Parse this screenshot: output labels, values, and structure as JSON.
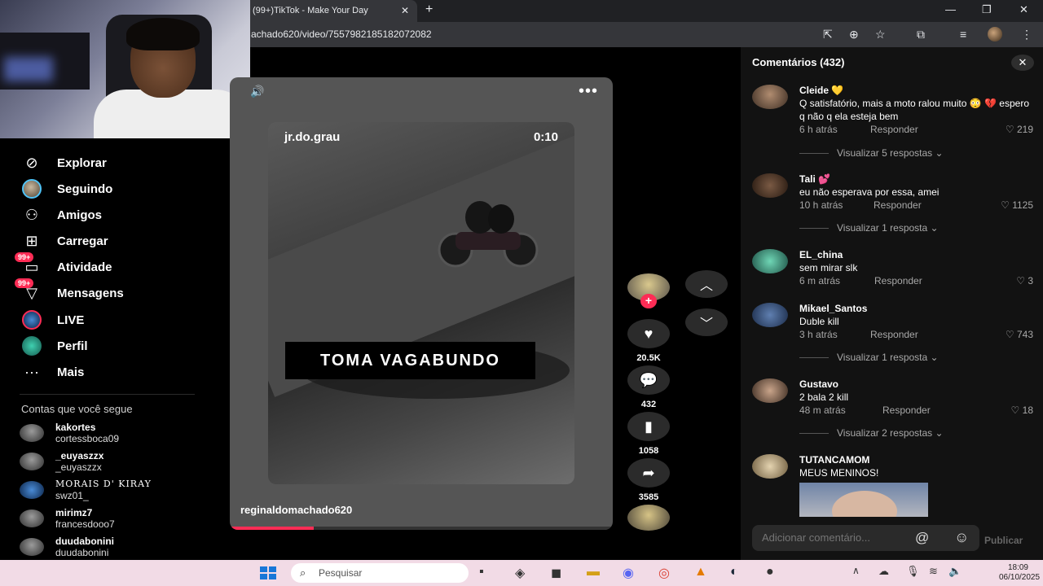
{
  "browser": {
    "tab_title": "(99+)TikTok - Make Your Day",
    "url": "achado620/video/7557982185182072082"
  },
  "nav": {
    "items": [
      {
        "label": "Explorar",
        "icon": "compass-icon"
      },
      {
        "label": "Seguindo",
        "icon": "avatar-icon"
      },
      {
        "label": "Amigos",
        "icon": "friends-icon"
      },
      {
        "label": "Carregar",
        "icon": "upload-icon"
      },
      {
        "label": "Atividade",
        "icon": "activity-icon",
        "badge": "99+"
      },
      {
        "label": "Mensagens",
        "icon": "messages-icon",
        "badge": "99+"
      },
      {
        "label": "LIVE",
        "icon": "live-icon"
      },
      {
        "label": "Perfil",
        "icon": "profile-icon"
      },
      {
        "label": "Mais",
        "icon": "more-icon"
      }
    ],
    "following_title": "Contas que você segue",
    "following": [
      {
        "name": "kakortes",
        "handle": "cortessboca09"
      },
      {
        "name": "_euyaszzx",
        "handle": "_euyaszzx"
      },
      {
        "name": "MORAIS D' KIRAY",
        "handle": "swz01_"
      },
      {
        "name": "mirimz7",
        "handle": "francesdooo7"
      },
      {
        "name": "duudabonini",
        "handle": "duudabonini"
      }
    ]
  },
  "video": {
    "overlay_user": "jr.do.grau",
    "overlay_time": "0:10",
    "caption": "TOMA  VAGABUNDO",
    "author": "reginaldomachado620",
    "progress": 0.22
  },
  "actions": {
    "likes": "20.5K",
    "comments": "432",
    "saves": "1058",
    "shares": "3585"
  },
  "comments": {
    "title": "Comentários (432)",
    "reply_label": "Responder",
    "input_placeholder": "Adicionar comentário...",
    "post_label": "Publicar",
    "items": [
      {
        "user": "Cleide 💛",
        "text": "Q satisfatório, mais a moto ralou muito 😳 💔 espero q não q ela esteja bem",
        "time": "6 h atrás",
        "likes": "219",
        "view": "Visualizar 5 respostas"
      },
      {
        "user": "Tali 💕",
        "text": "eu não esperava por essa, amei",
        "time": "10 h atrás",
        "likes": "1125",
        "view": "Visualizar 1 resposta"
      },
      {
        "user": "EL_china",
        "text": "sem mirar slk",
        "time": "6 m atrás",
        "likes": "3",
        "view": ""
      },
      {
        "user": "Mikael_Santos",
        "text": "Duble kill",
        "time": "3 h atrás",
        "likes": "743",
        "view": "Visualizar 1 resposta"
      },
      {
        "user": "Gustavo",
        "text": "2 bala 2 kill",
        "time": "48 m atrás",
        "likes": "18",
        "view": "Visualizar 2 respostas"
      },
      {
        "user": "TUTANCAMOM",
        "text": "MEUS MENINOS!",
        "time": "",
        "likes": "",
        "view": ""
      }
    ]
  },
  "taskbar": {
    "search_placeholder": "Pesquisar",
    "time": "18:09",
    "date": "06/10/2025"
  }
}
